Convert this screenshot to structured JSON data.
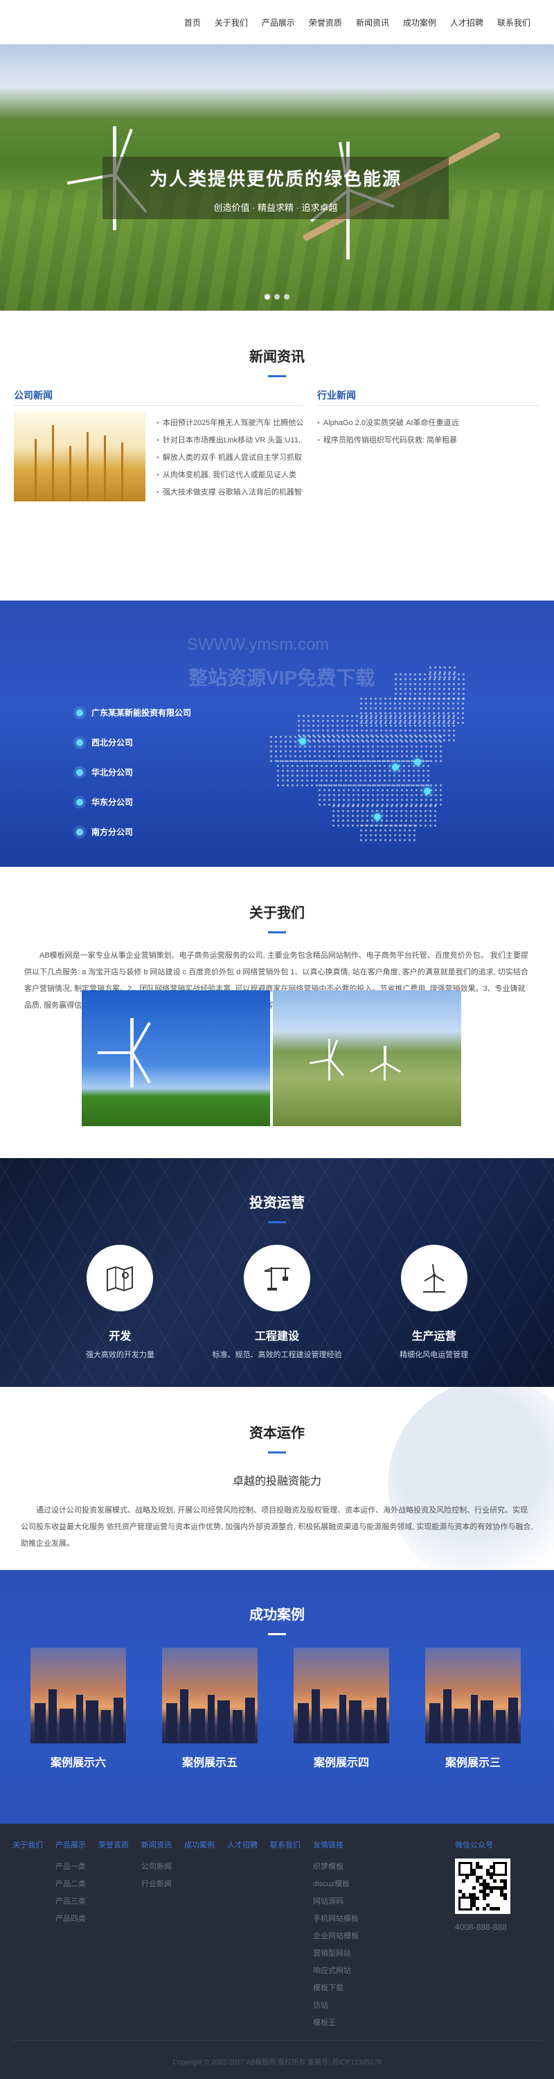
{
  "nav": [
    "首页",
    "关于我们",
    "产品展示",
    "荣誉资质",
    "新闻资讯",
    "成功案例",
    "人才招聘",
    "联系我们"
  ],
  "hero": {
    "title": "为人类提供更优质的绿色能源",
    "subtitle": "创造价值 · 精益求精 · 追求卓越"
  },
  "news": {
    "title": "新闻资讯",
    "company_title": "公司新闻",
    "industry_title": "行业新闻",
    "company_items": [
      "本田预计2025年推无人驾驶汽车 比腾他公",
      "针对日本市场推出Link移动 VR 头盔:U11...",
      "解放人类的双手 机器人尝试自主学习抓取",
      "从肉体变机器, 我们这代人或能见证人类",
      "强大技术做支撑 谷歌输入法背后的机器智"
    ],
    "industry_items": [
      "AlphaGo 2.0没实质突破 AI革命任重道远",
      "程序员陷传销组织写代码获救: 简单粗暴"
    ]
  },
  "branches": {
    "watermark1": "SWWW.ymsm.com",
    "watermark2": "整站资源VIP免费下载",
    "items": [
      "广东某某新能投资有限公司",
      "西北分公司",
      "华北分公司",
      "华东分公司",
      "南方分公司"
    ]
  },
  "about": {
    "title": "关于我们",
    "text": "AB模板网是一家专业从事企业营销策划、电子商务运营服务的公司, 主要业务包含精品网站制作、电子商务平台托管、百度竞价外包。 我们主要提供以下几点服务: a 淘宝开店与装修 b 网站建设 c 百度竞价外包 d 网络营销外包 1、以真心换真情, 站在客户角度, 客户的满意就是我们的追求, 切实结合客户营销情况, 制定营销方案。2、团队网络营销实战经验丰富, 可以规避商家在网络营销中不必要的投入。节省推广费用, 增强营销效果。3、专业铸就品质, 服务赢得信赖, 专业的技术水平是我们的根本, 贴心的服务是我们和客户之间的友谊桥梁。AB模板网自成立以来, —..."
  },
  "invest": {
    "title": "投资运营",
    "items": [
      {
        "name": "开发",
        "desc": "强大高效的开发力量",
        "icon": "map-icon"
      },
      {
        "name": "工程建设",
        "desc": "标准、规范、高效的工程建设管理经验",
        "icon": "crane-icon"
      },
      {
        "name": "生产运营",
        "desc": "精细化风电运营管理",
        "icon": "wind-turbine-icon"
      }
    ]
  },
  "capital": {
    "title": "资本运作",
    "subtitle": "卓越的投融资能力",
    "text": "通过设计公司投资发展模式、战略及规划, 开展公司经营风险控制、项目投融资及股权管理、资本运作、海外战略投资及风险控制、行业研究、实现公司股东收益最大化服务 依托资产管理运营与资本运作优势, 加强内外部资源整合, 积极拓展融资渠道与能源服务领域, 实现能源与资本的有效协作与融合, 助推企业发展。"
  },
  "cases": {
    "title": "成功案例",
    "items": [
      "案例展示六",
      "案例展示五",
      "案例展示四",
      "案例展示三"
    ]
  },
  "footer": {
    "cols": [
      {
        "title": "关于我们",
        "links": []
      },
      {
        "title": "产品展示",
        "links": [
          "产品一类",
          "产品二类",
          "产品三类",
          "产品四类"
        ]
      },
      {
        "title": "荣誉资质",
        "links": []
      },
      {
        "title": "新闻资讯",
        "links": [
          "公司新闻",
          "行业新闻"
        ]
      },
      {
        "title": "成功案例",
        "links": []
      },
      {
        "title": "人才招聘",
        "links": []
      },
      {
        "title": "联系我们",
        "links": []
      },
      {
        "title": "友情链接",
        "links": [
          "织梦模板",
          "discuz模板",
          "网站源码",
          "手机网站模板",
          "企业网站模板",
          "营销型网站",
          "响应式网站",
          "模板下载",
          "仿站",
          "模板王"
        ]
      }
    ],
    "qr_title": "微信公众号",
    "phone": "4008-888-888",
    "copyright": "Copyright © 2002-2017 AB模板网 版权所有 备案号: 苏ICP12345678"
  },
  "colors": {
    "accent": "#2f6bd3",
    "section_blue": "#2d59c5",
    "footer_bg": "#272c38"
  }
}
